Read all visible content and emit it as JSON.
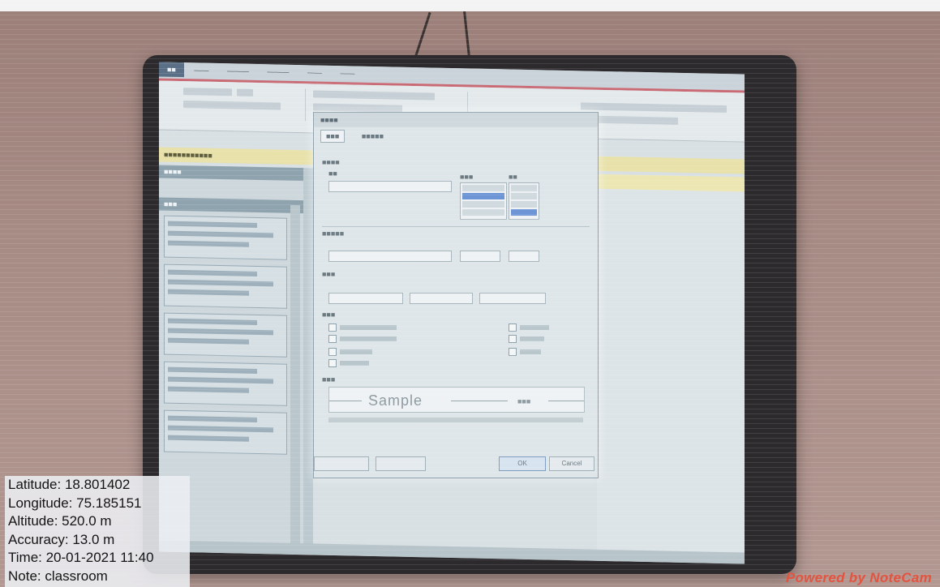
{
  "overlay": {
    "latitude": "Latitude: 18.801402",
    "longitude": "Longitude: 75.185151",
    "altitude": "Altitude: 520.0 m",
    "accuracy": "Accuracy: 13.0 m",
    "time": "Time: 20-01-2021 11:40",
    "note": "Note: classroom"
  },
  "watermark": "Powered by NoteCam",
  "dialog": {
    "preview_sample": "Sample",
    "ok_label": "OK",
    "cancel_label": "Cancel"
  }
}
